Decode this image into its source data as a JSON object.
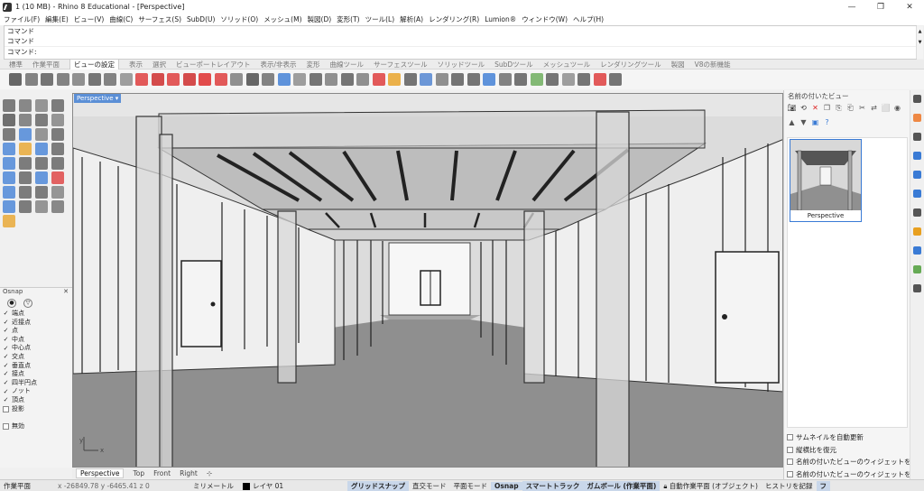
{
  "window": {
    "title": "1 (10 MB) - Rhino 8 Educational - [Perspective]",
    "controls": [
      "—",
      "❐",
      "✕"
    ]
  },
  "menu": [
    "ファイル(F)",
    "編集(E)",
    "ビュー(V)",
    "曲線(C)",
    "サーフェス(S)",
    "SubD(U)",
    "ソリッド(O)",
    "メッシュ(M)",
    "製図(D)",
    "変形(T)",
    "ツール(L)",
    "解析(A)",
    "レンダリング(R)",
    "Lumion®",
    "ウィンドウ(W)",
    "ヘルプ(H)"
  ],
  "command": {
    "history": [
      "コマンド",
      "コマンド"
    ],
    "prompt": "コマンド:"
  },
  "toolbar_tabs": [
    "標準",
    "作業平面",
    "ビューの設定",
    "表示",
    "選択",
    "ビューポートレイアウト",
    "表示/非表示",
    "変形",
    "曲線ツール",
    "サーフェスツール",
    "ソリッドツール",
    "SubDツール",
    "メッシュツール",
    "レンダリングツール",
    "製図",
    "V8の新機能"
  ],
  "active_toolbar_tab": "ビューの設定",
  "viewport": {
    "label": "Perspective",
    "label_arrow": "▾",
    "axis_x": "x",
    "axis_y": "y"
  },
  "view_tabs": [
    "Perspective",
    "Top",
    "Front",
    "Right",
    "⊹"
  ],
  "osnap": {
    "title": "Osnap",
    "items": [
      {
        "label": "端点",
        "checked": true
      },
      {
        "label": "近接点",
        "checked": true
      },
      {
        "label": "点",
        "checked": true
      },
      {
        "label": "中点",
        "checked": true
      },
      {
        "label": "中心点",
        "checked": true
      },
      {
        "label": "交点",
        "checked": true
      },
      {
        "label": "垂直点",
        "checked": true
      },
      {
        "label": "接点",
        "checked": true
      },
      {
        "label": "四半円点",
        "checked": true
      },
      {
        "label": "ノット",
        "checked": true
      },
      {
        "label": "頂点",
        "checked": true
      },
      {
        "label": "投影",
        "checked": false
      },
      {
        "label": "無効",
        "checked": false
      }
    ]
  },
  "named_views": {
    "title": "名前の付いたビュー",
    "thumbnail_label": "Perspective",
    "options": [
      "サムネイルを自動更新",
      "縦横比を復元",
      "名前の付いたビューのウィジェットを",
      "名前の付いたビューのウィジェットを"
    ]
  },
  "status": {
    "cplane": "作業平面",
    "coords": "x -26849.78   y -6465.41   z 0",
    "units": "ミリメートル",
    "layer": "レイヤ 01",
    "grid_snap": "グリッドスナップ",
    "ortho": "直交モード",
    "planar": "平面モード",
    "osnap": "Osnap",
    "smarttrack": "スマートトラック",
    "gumball": "ガムボール (作業平面)",
    "auto_cplane": "自動作業平面 (オブジェクト)",
    "history": "ヒストリを記録",
    "filter": "フ"
  },
  "colors": {
    "accent": "#5b8fd6",
    "viewport_bg": "#d7d7d7",
    "floor": "#8f8f8f"
  }
}
